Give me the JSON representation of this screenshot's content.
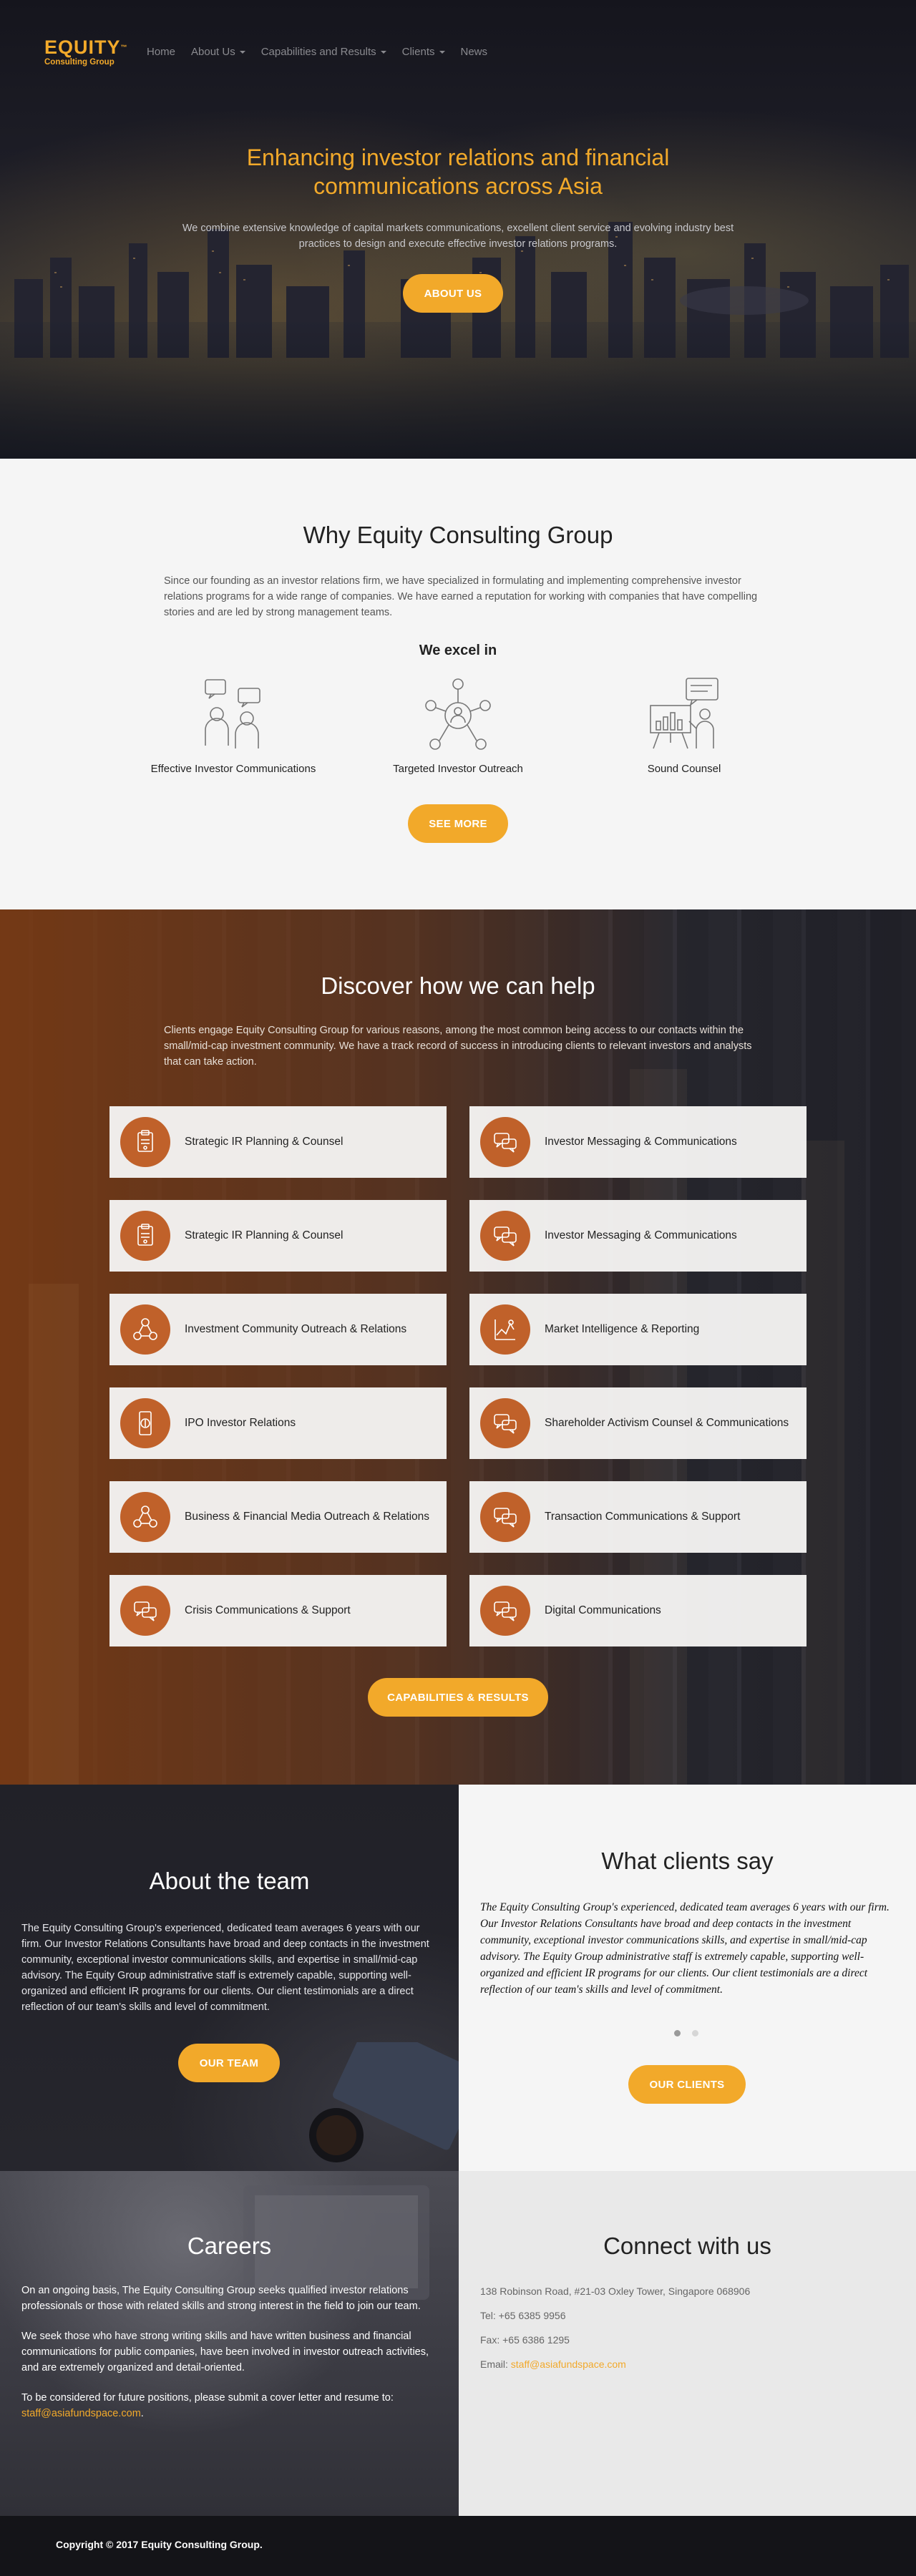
{
  "nav": {
    "logo_main": "EQUITY",
    "logo_tm": "™",
    "logo_sub": "Consulting Group",
    "items": [
      {
        "label": "Home",
        "dropdown": false,
        "active": true
      },
      {
        "label": "About Us",
        "dropdown": true,
        "active": false
      },
      {
        "label": "Capabilities and Results",
        "dropdown": true,
        "active": false
      },
      {
        "label": "Clients",
        "dropdown": true,
        "active": false
      },
      {
        "label": "News",
        "dropdown": false,
        "active": false
      }
    ]
  },
  "hero": {
    "title": "Enhancing investor relations and financial communications across Asia",
    "text": "We combine extensive knowledge of capital markets communications, excellent client service and evolving industry best practices to design and execute effective investor relations programs.",
    "button": "ABOUT US"
  },
  "why": {
    "title": "Why Equity Consulting Group",
    "text": "Since our founding as an investor relations firm, we have specialized in formulating and implementing comprehensive investor relations programs for a wide range of companies. We have earned a reputation for working with companies that have compelling stories and are led by strong management teams.",
    "excel_title": "We excel in",
    "features": [
      {
        "label": "Effective Investor Communications",
        "icon": "people-talking-icon"
      },
      {
        "label": "Targeted Investor Outreach",
        "icon": "network-icon"
      },
      {
        "label": "Sound Counsel",
        "icon": "presentation-board-icon"
      }
    ],
    "button": "SEE MORE"
  },
  "discover": {
    "title": "Discover how we can help",
    "text": "Clients engage Equity Consulting Group for various reasons, among the most common being access to our contacts within the small/mid-cap investment community. We have a track record of success in introducing clients to relevant investors and analysts that can take action.",
    "services": [
      {
        "label": "Strategic IR Planning & Counsel",
        "icon": "clipboard-icon"
      },
      {
        "label": "Investor Messaging & Communications",
        "icon": "chat-icon"
      },
      {
        "label": "Strategic IR Planning & Counsel",
        "icon": "clipboard-icon"
      },
      {
        "label": "Investor Messaging & Communications",
        "icon": "chat-icon"
      },
      {
        "label": "Investment Community Outreach & Relations",
        "icon": "people-network-icon"
      },
      {
        "label": "Market Intelligence & Reporting",
        "icon": "chart-icon"
      },
      {
        "label": "IPO Investor Relations",
        "icon": "money-icon"
      },
      {
        "label": "Shareholder Activism Counsel & Communications",
        "icon": "chat-icon"
      },
      {
        "label": "Business & Financial Media Outreach & Relations",
        "icon": "people-network-icon"
      },
      {
        "label": "Transaction Communications & Support",
        "icon": "chat-icon"
      },
      {
        "label": "Crisis Communications & Support",
        "icon": "chat-icon"
      },
      {
        "label": "Digital Communications",
        "icon": "chat-icon"
      }
    ],
    "button": "CAPABILITIES & RESULTS"
  },
  "about": {
    "title": "About the team",
    "text": "The Equity Consulting Group's experienced, dedicated team averages 6 years with our firm. Our Investor Relations Consultants have broad and deep contacts in the investment community, exceptional investor communications skills, and expertise in small/mid-cap advisory. The Equity Group administrative staff is extremely capable, supporting well-organized and efficient IR programs for our clients. Our client testimonials are a direct reflection of our team's skills and level of commitment.",
    "button": "OUR TEAM"
  },
  "clients": {
    "title": "What clients say",
    "quote": "The Equity Consulting Group's experienced, dedicated team averages 6 years with our firm. Our Investor Relations Consultants have broad and deep contacts in the investment community, exceptional investor communications skills, and expertise in small/mid-cap advisory. The Equity Group administrative staff is extremely capable, supporting well-organized and efficient IR programs for our clients. Our client testimonials are a direct reflection of our team's skills and level of commitment.",
    "button": "OUR CLIENTS",
    "slides": 2,
    "active_slide": 1
  },
  "careers": {
    "title": "Careers",
    "p1": "On an ongoing basis, The Equity Consulting Group seeks qualified investor relations professionals or those with related skills and strong interest in the field to join our team.",
    "p2": "We seek those who have strong writing skills and have written business and financial communications for public companies, have been involved in investor outreach activities, and are extremely organized and detail-oriented.",
    "p3": "To be considered for future positions, please submit a cover letter and resume to:",
    "email": "staff@asiafundspace.com",
    "email_suffix": "."
  },
  "connect": {
    "title": "Connect with us",
    "address": "138 Robinson Road, #21-03 Oxley Tower, Singapore 068906",
    "tel": "Tel: +65 6385 9956",
    "fax": "Fax: +65 6386 1295",
    "email_label": "Email: ",
    "email": "staff@asiafundspace.com"
  },
  "footer": {
    "copyright": "Copyright © 2017 Equity Consulting Group."
  },
  "colors": {
    "accent": "#f2a92a",
    "icon_circle": "#c0612a"
  }
}
